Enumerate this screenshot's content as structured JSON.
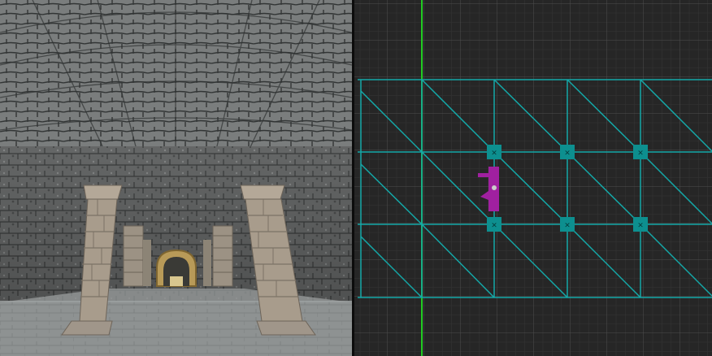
{
  "editor": {
    "panes": [
      {
        "id": "3d",
        "label": ""
      },
      {
        "id": "2d-top",
        "label": ""
      }
    ]
  },
  "colors": {
    "wall_stone": "#6c6e6e",
    "wall_dark": "#3f4242",
    "ceiling_stone": "#7d8080",
    "floor": "#8f9393",
    "pillar": "#a89c8c",
    "pillar_shadow": "#7c7266",
    "arch_gold": "#b89a58",
    "grid_bg": "#262626",
    "grid_minor": "#3a3a3a",
    "grid_major": "#555555",
    "axis_green": "#22cc22",
    "brush_cyan": "#0fa5a5",
    "vertex_teal": "#0d8f8f",
    "entity_magenta": "#a020a0"
  },
  "top_view": {
    "entity_icon": "player-start-icon",
    "vertex_icon": "vertex-handle-icon"
  }
}
